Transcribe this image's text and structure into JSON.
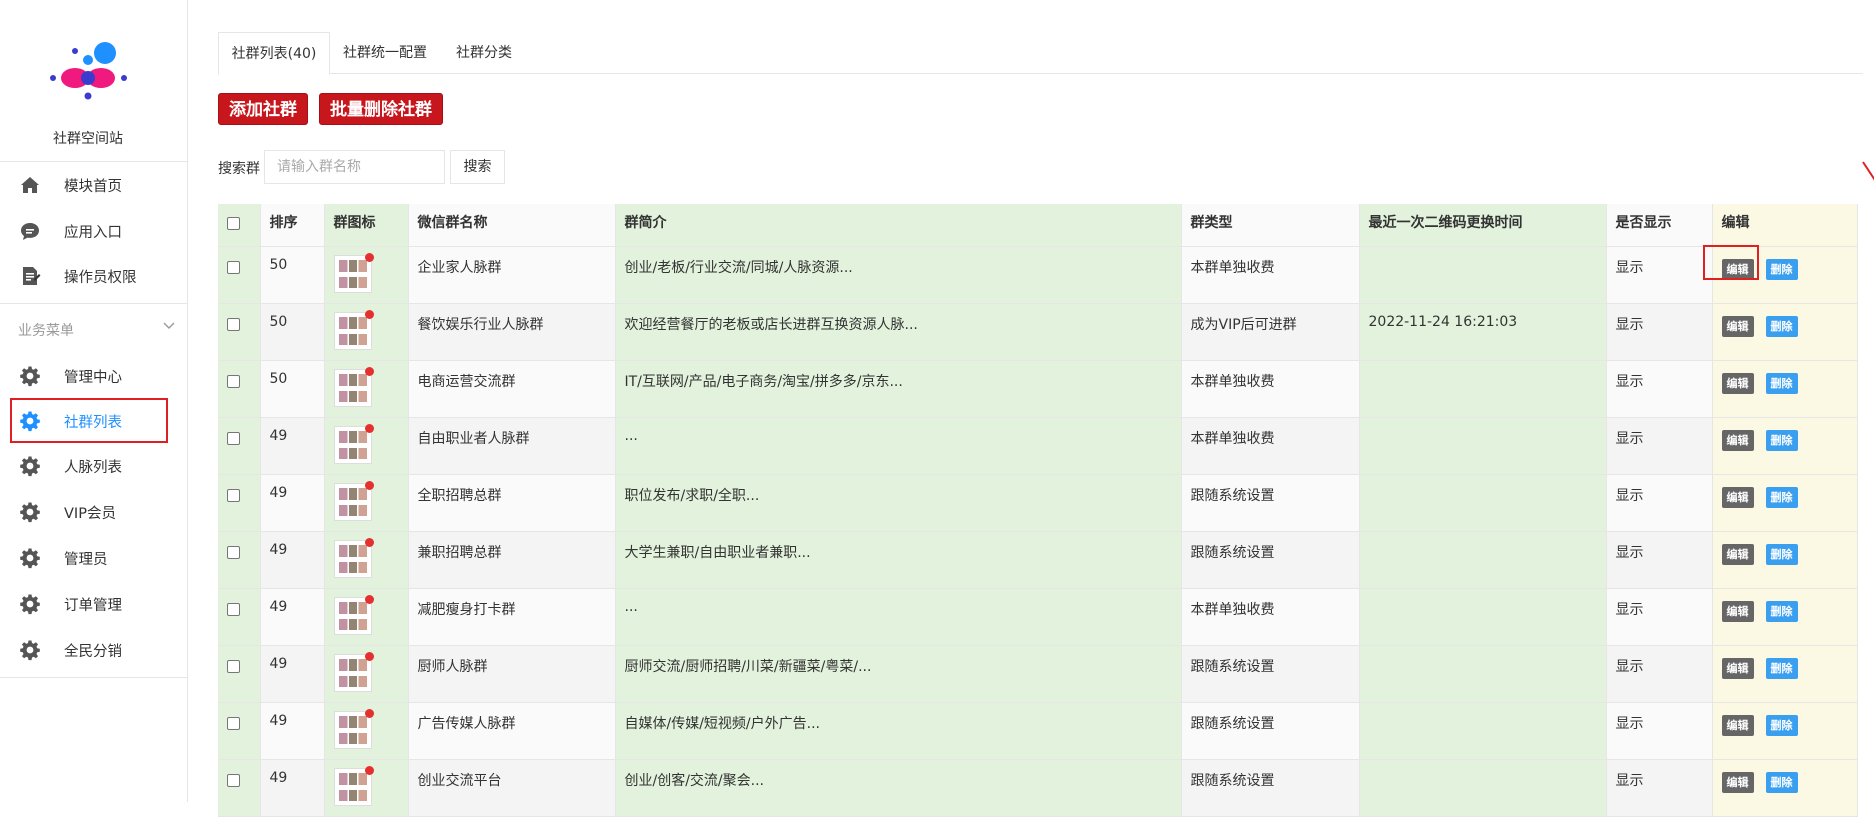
{
  "sidebar": {
    "site_name": "社群空间站",
    "top_items": [
      {
        "label": "模块首页",
        "icon": "home-icon"
      },
      {
        "label": "应用入口",
        "icon": "chat-icon"
      },
      {
        "label": "操作员权限",
        "icon": "document-edit-icon"
      }
    ],
    "section_label": "业务菜单",
    "section_items": [
      {
        "label": "管理中心",
        "icon": "gear-icon"
      },
      {
        "label": "社群列表",
        "icon": "gear-icon",
        "active": true
      },
      {
        "label": "人脉列表",
        "icon": "gear-icon"
      },
      {
        "label": "VIP会员",
        "icon": "gear-icon"
      },
      {
        "label": "管理员",
        "icon": "gear-icon"
      },
      {
        "label": "订单管理",
        "icon": "gear-icon"
      },
      {
        "label": "全民分销",
        "icon": "gear-icon"
      }
    ]
  },
  "tabs": [
    "社群列表(40)",
    "社群统一配置",
    "社群分类"
  ],
  "toolbar": {
    "add_label": "添加社群",
    "batch_delete_label": "批量删除社群"
  },
  "search": {
    "label": "搜索群",
    "placeholder": "请输入群名称",
    "button": "搜索"
  },
  "table": {
    "headers": [
      "排序",
      "群图标",
      "微信群名称",
      "群简介",
      "群类型",
      "最近一次二维码更换时间",
      "是否显示",
      "编辑"
    ],
    "edit_label": "编辑",
    "delete_label": "删除",
    "rows": [
      {
        "sort": "50",
        "name": "企业家人脉群",
        "intro": "创业/老板/行业交流/同城/人脉资源...",
        "type": "本群单独收费",
        "qr_time": "",
        "show": "显示"
      },
      {
        "sort": "50",
        "name": "餐饮娱乐行业人脉群",
        "intro": "欢迎经营餐厅的老板或店长进群互换资源人脉...",
        "type": "成为VIP后可进群",
        "qr_time": "2022-11-24 16:21:03",
        "show": "显示"
      },
      {
        "sort": "50",
        "name": "电商运营交流群",
        "intro": "IT/互联网/产品/电子商务/淘宝/拼多多/京东...",
        "type": "本群单独收费",
        "qr_time": "",
        "show": "显示"
      },
      {
        "sort": "49",
        "name": "自由职业者人脉群",
        "intro": "...",
        "type": "本群单独收费",
        "qr_time": "",
        "show": "显示"
      },
      {
        "sort": "49",
        "name": "全职招聘总群",
        "intro": "职位发布/求职/全职...",
        "type": "跟随系统设置",
        "qr_time": "",
        "show": "显示"
      },
      {
        "sort": "49",
        "name": "兼职招聘总群",
        "intro": "大学生兼职/自由职业者兼职...",
        "type": "跟随系统设置",
        "qr_time": "",
        "show": "显示"
      },
      {
        "sort": "49",
        "name": "减肥瘦身打卡群",
        "intro": "...",
        "type": "本群单独收费",
        "qr_time": "",
        "show": "显示"
      },
      {
        "sort": "49",
        "name": "厨师人脉群",
        "intro": "厨师交流/厨师招聘/川菜/新疆菜/粤菜/...",
        "type": "跟随系统设置",
        "qr_time": "",
        "show": "显示"
      },
      {
        "sort": "49",
        "name": "广告传媒人脉群",
        "intro": "自媒体/传媒/短视频/户外广告...",
        "type": "跟随系统设置",
        "qr_time": "",
        "show": "显示"
      },
      {
        "sort": "49",
        "name": "创业交流平台",
        "intro": "创业/创客/交流/聚会...",
        "type": "跟随系统设置",
        "qr_time": "",
        "show": "显示"
      }
    ]
  },
  "colors": {
    "primary_red": "#c8161d",
    "active_blue": "#1e90ff",
    "delete_blue": "#3b9ff0",
    "edit_gray": "#666666",
    "highlight_red": "#e02020"
  }
}
